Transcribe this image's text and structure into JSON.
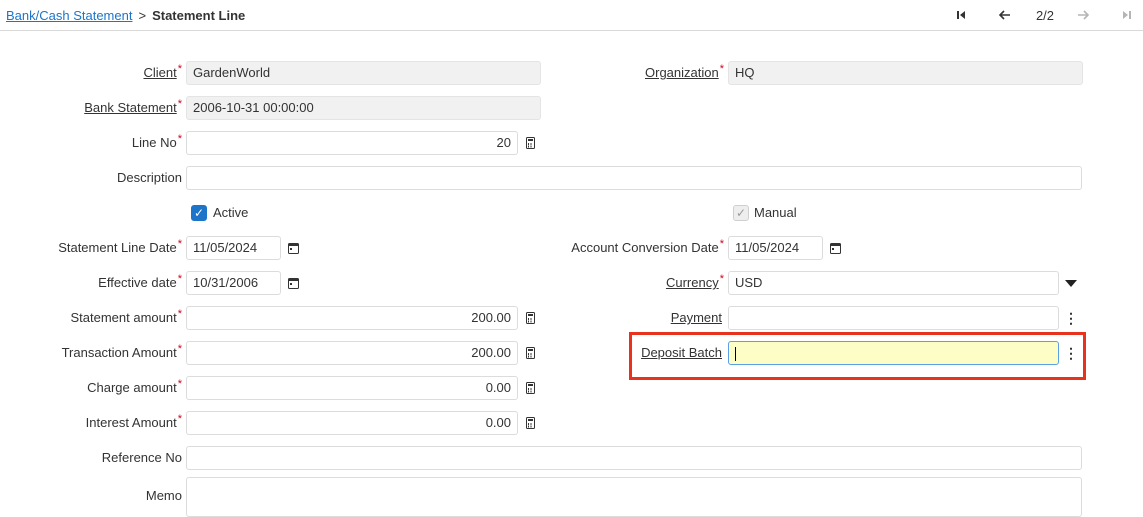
{
  "breadcrumb": {
    "parent": "Bank/Cash Statement",
    "separator": ">",
    "current": "Statement Line"
  },
  "nav": {
    "first_icon": "first-record-icon",
    "prev_icon": "previous-record-icon",
    "counter": "2/2",
    "next_icon": "next-record-icon",
    "last_icon": "last-record-icon"
  },
  "form": {
    "client": {
      "label": "Client",
      "value": "GardenWorld"
    },
    "organization": {
      "label": "Organization",
      "value": "HQ"
    },
    "bank_statement": {
      "label": "Bank Statement",
      "value": "2006-10-31 00:00:00"
    },
    "line_no": {
      "label": "Line No",
      "value": "20"
    },
    "description": {
      "label": "Description",
      "value": ""
    },
    "active": {
      "label": "Active",
      "checked": true
    },
    "manual": {
      "label": "Manual",
      "checked": true
    },
    "statement_line_date": {
      "label": "Statement Line Date",
      "value": "11/05/2024"
    },
    "account_conversion_date": {
      "label": "Account Conversion Date",
      "value": "11/05/2024"
    },
    "effective_date": {
      "label": "Effective date",
      "value": "10/31/2006"
    },
    "currency": {
      "label": "Currency",
      "value": "USD"
    },
    "statement_amount": {
      "label": "Statement amount",
      "value": "200.00"
    },
    "payment": {
      "label": "Payment",
      "value": ""
    },
    "transaction_amount": {
      "label": "Transaction Amount",
      "value": "200.00"
    },
    "deposit_batch": {
      "label": "Deposit Batch",
      "value": ""
    },
    "charge_amount": {
      "label": "Charge amount",
      "value": "0.00"
    },
    "interest_amount": {
      "label": "Interest Amount",
      "value": "0.00"
    },
    "reference_no": {
      "label": "Reference No",
      "value": ""
    },
    "memo": {
      "label": "Memo",
      "value": ""
    }
  },
  "colors": {
    "link": "#1c75c9",
    "required": "#d0021b",
    "focus_bg": "#fdfdc6",
    "highlight": "#e8321e",
    "checkbox": "#1c75c9"
  }
}
